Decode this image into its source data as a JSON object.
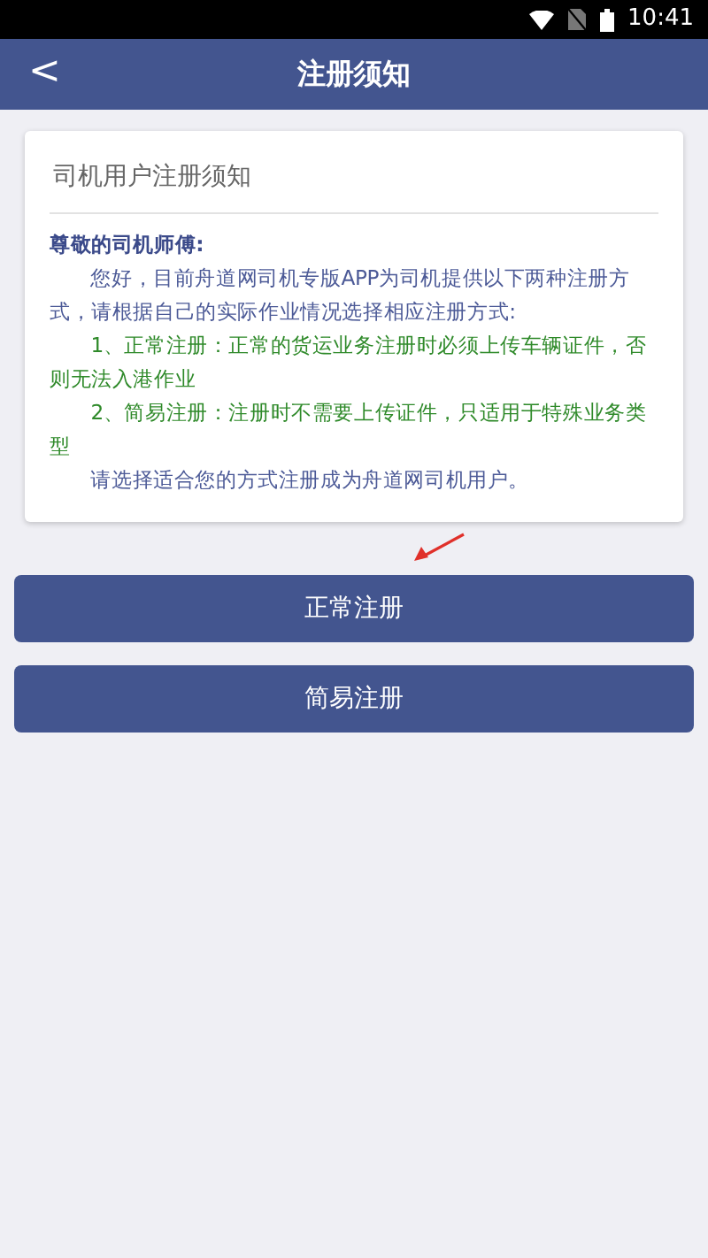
{
  "status_bar": {
    "time": "10:41"
  },
  "header": {
    "back": "<",
    "title": "注册须知"
  },
  "notice": {
    "title": "司机用户注册须知",
    "paragraphs": [
      {
        "kind": "greeting",
        "text": "尊敬的司机师傅:"
      },
      {
        "kind": "body",
        "text": "您好，目前舟道网司机专版APP为司机提供以下两种注册方式，请根据自己的实际作业情况选择相应注册方式:"
      },
      {
        "kind": "option",
        "text": "1、正常注册：正常的货运业务注册时必须上传车辆证件，否则无法入港作业"
      },
      {
        "kind": "option",
        "text": "2、简易注册：注册时不需要上传证件，只适用于特殊业务类型"
      },
      {
        "kind": "body",
        "text": "请选择适合您的方式注册成为舟道网司机用户。"
      }
    ]
  },
  "buttons": [
    "正常注册",
    "简易注册"
  ]
}
